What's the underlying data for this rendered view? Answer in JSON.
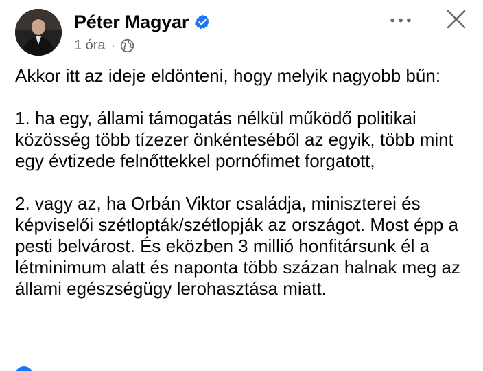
{
  "author": {
    "name": "Péter Magyar",
    "verified_icon": "verified-badge-icon",
    "avatar_icon": "avatar-photo"
  },
  "meta": {
    "time": "1 óra",
    "separator": "·",
    "audience_icon": "globe-icon"
  },
  "actions": {
    "more_icon": "more-options-icon",
    "close_icon": "close-icon"
  },
  "post": {
    "paragraphs": [
      "Akkor itt az ideje eldönteni, hogy melyik nagyobb bűn:",
      "1. ha egy, állami támogatás nélkül működő politikai közösség több tízezer önkénteséből az egyik, több mint egy évtizede felnőttekkel pornófimet forgatott,",
      "2. vagy az, ha Orbán Viktor családja, miniszterei és képviselői szétlopták/szétlopják az országot. Most épp a pesti belvárost. És eközben 3 millió honfitársunk él a létminimum alatt és naponta több százan halnak meg az állami egészségügy lerohasztása miatt."
    ]
  },
  "colors": {
    "text": "#050505",
    "secondary": "#65676b",
    "accent": "#1877f2"
  }
}
